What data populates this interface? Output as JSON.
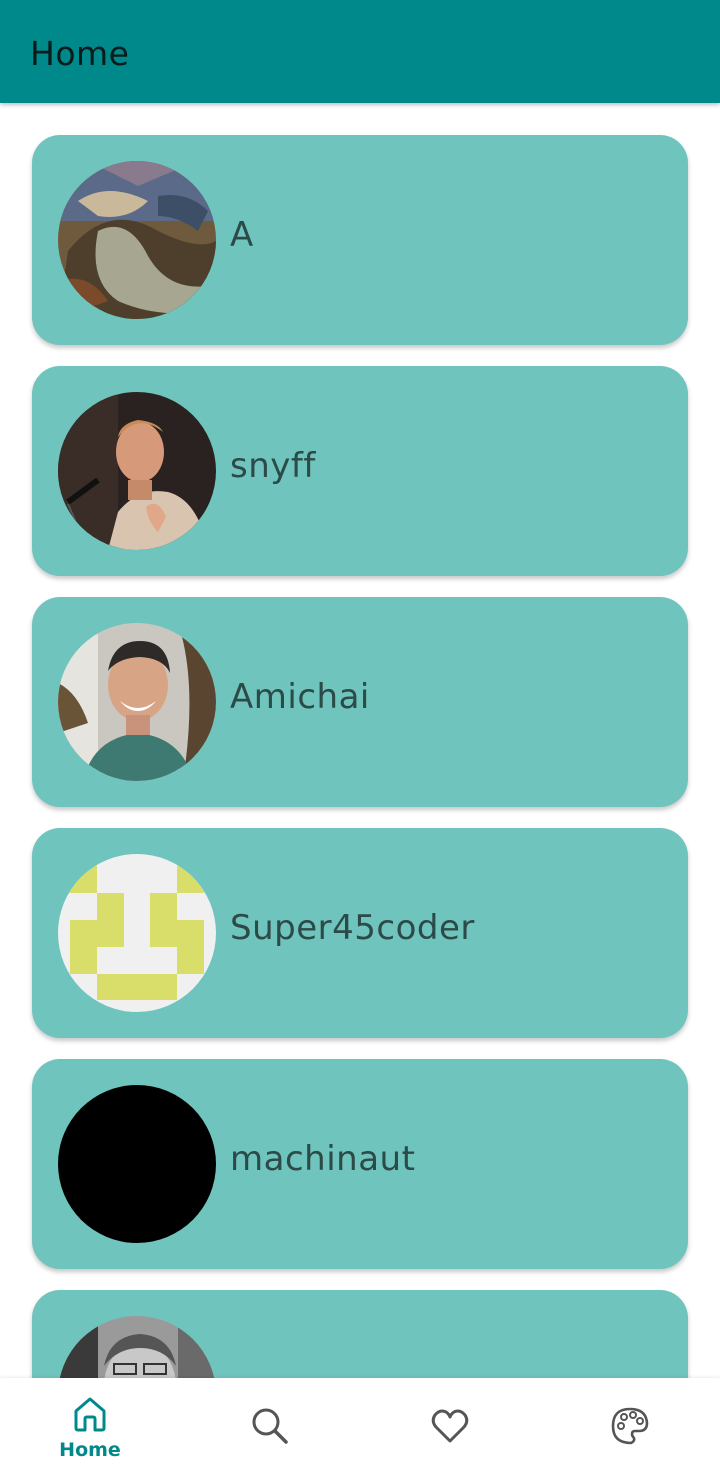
{
  "app_bar": {
    "title": "Home"
  },
  "users": [
    {
      "username": "A"
    },
    {
      "username": "snyff"
    },
    {
      "username": "Amichai"
    },
    {
      "username": "Super45coder"
    },
    {
      "username": "machinaut"
    },
    {
      "username": ""
    }
  ],
  "bottom_nav": {
    "items": [
      {
        "label": "Home",
        "icon": "home-icon",
        "selected": true
      },
      {
        "label": "",
        "icon": "search-icon",
        "selected": false
      },
      {
        "label": "",
        "icon": "heart-icon",
        "selected": false
      },
      {
        "label": "",
        "icon": "palette-icon",
        "selected": false
      }
    ]
  },
  "colors": {
    "app_bar": "#00898a",
    "card": "#6fc5bd",
    "accent": "#00898a",
    "text": "#2c4a48"
  }
}
